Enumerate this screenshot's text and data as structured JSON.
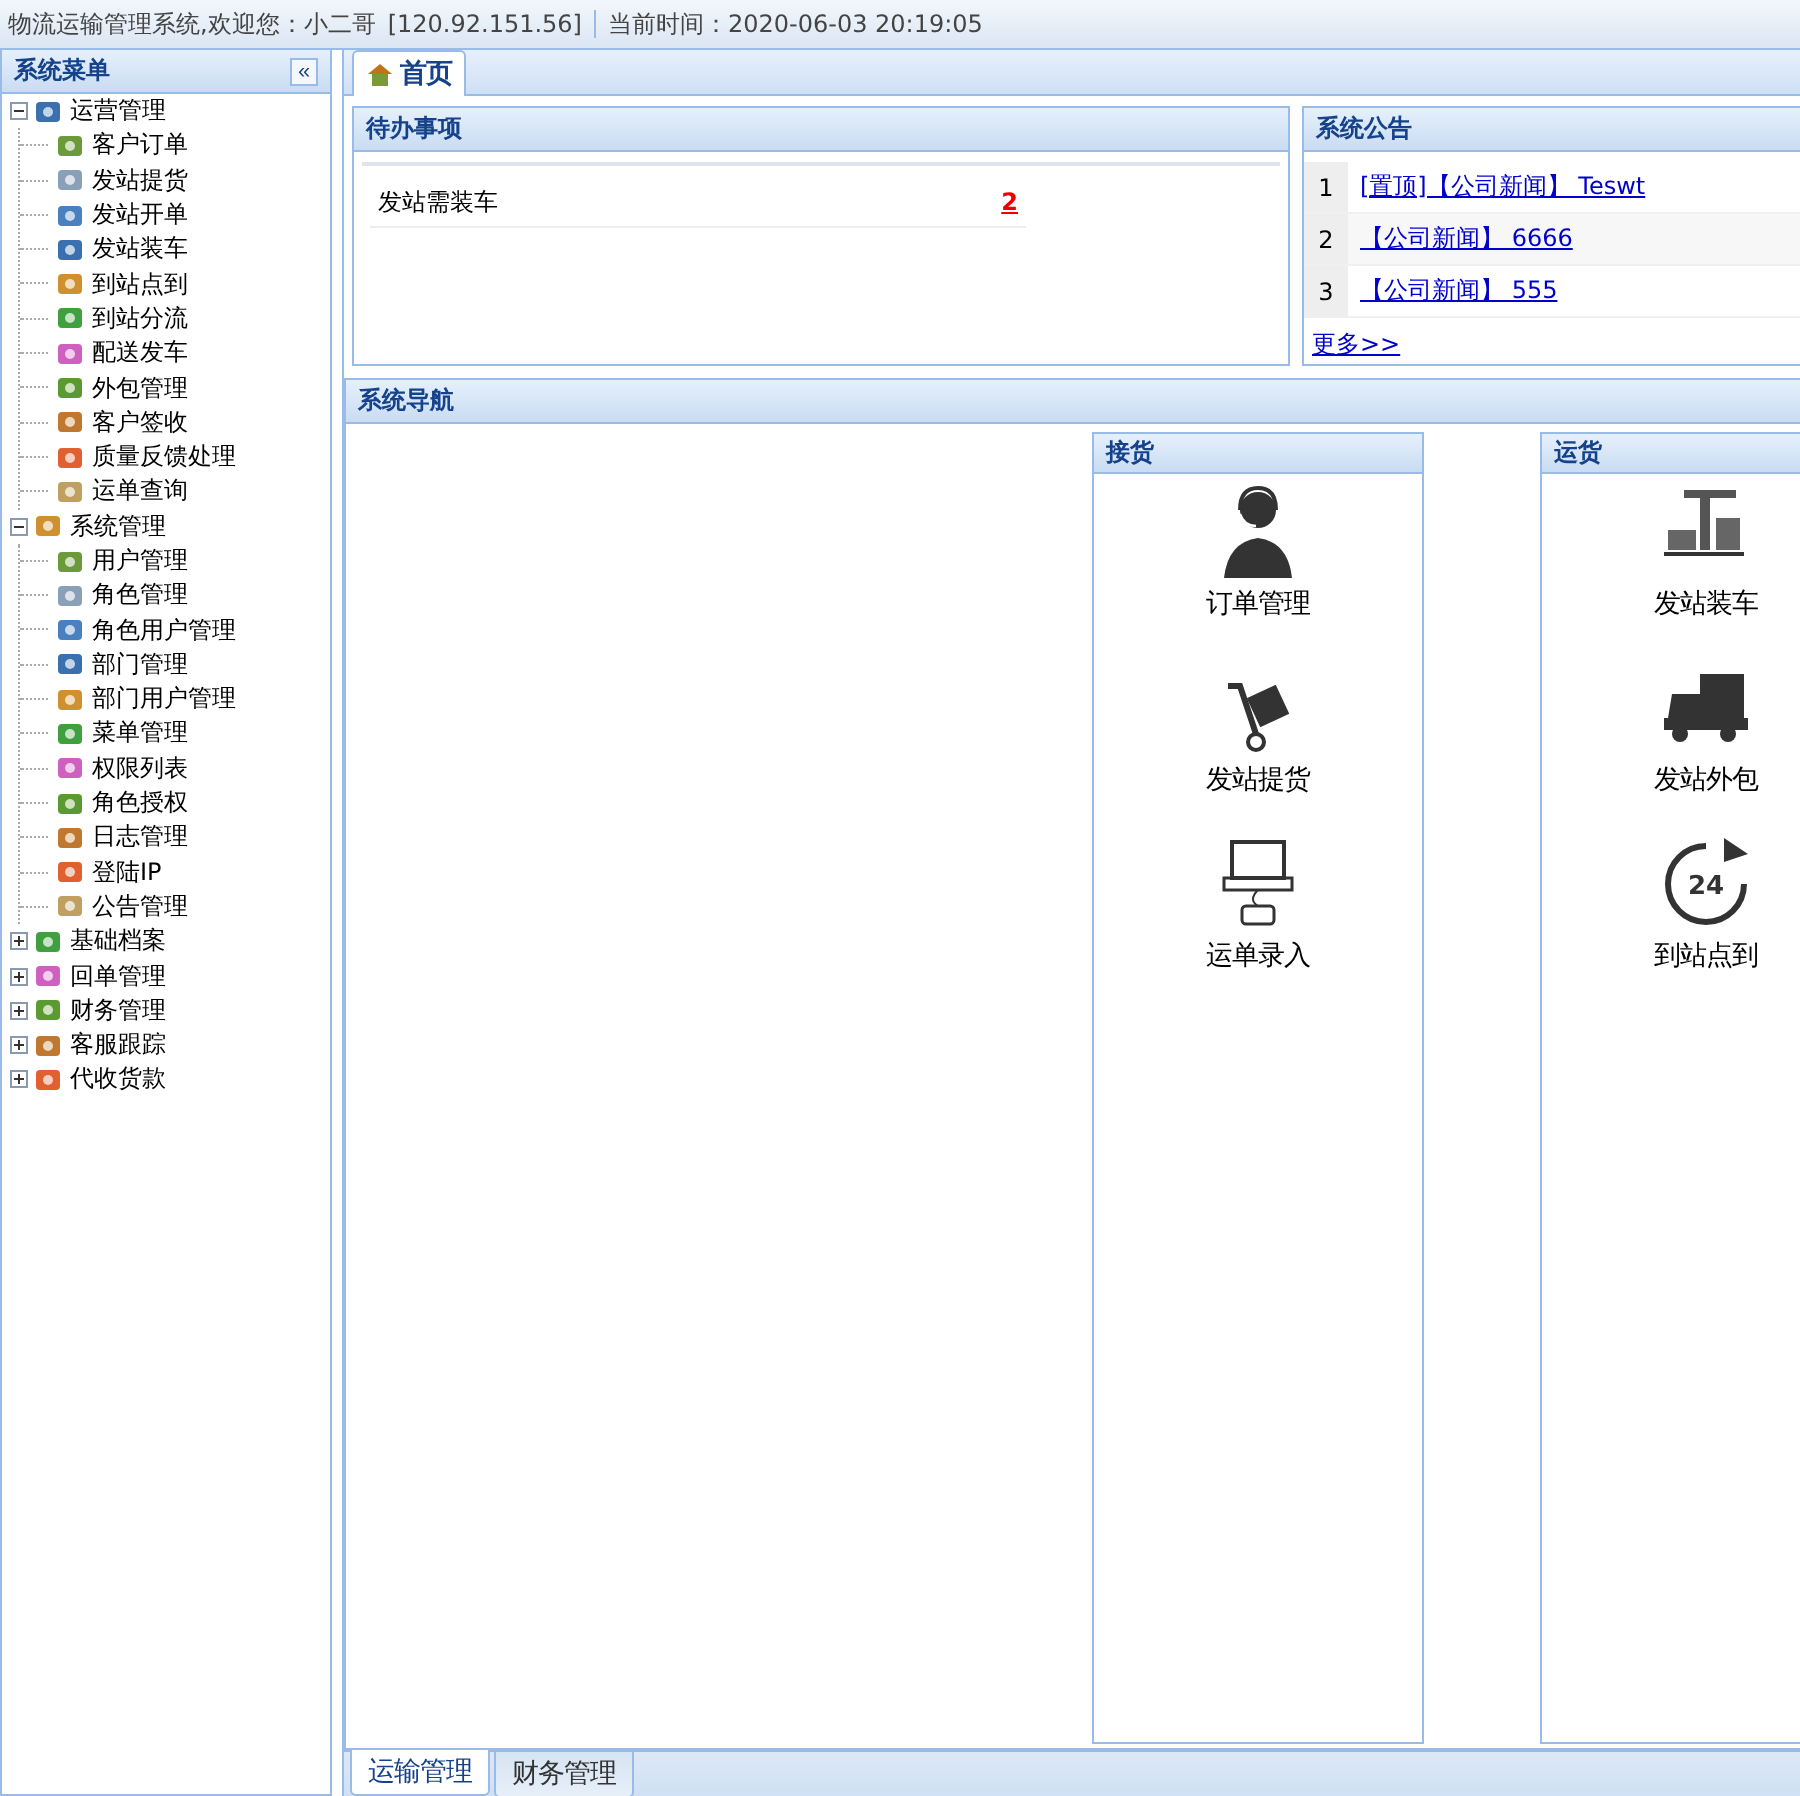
{
  "top_bar": {
    "welcome": "物流运输管理系统,欢迎您：小二哥",
    "ip": "[120.92.151.56]",
    "time": "当前时间：2020-06-03 20:19:05"
  },
  "sidebar": {
    "title": "系统菜单",
    "collapse": "«",
    "groups": [
      {
        "label": "运营管理",
        "expanded": true,
        "children": [
          {
            "label": "客户订单"
          },
          {
            "label": "发站提货"
          },
          {
            "label": "发站开单"
          },
          {
            "label": "发站装车"
          },
          {
            "label": "到站点到"
          },
          {
            "label": "到站分流"
          },
          {
            "label": "配送发车"
          },
          {
            "label": "外包管理"
          },
          {
            "label": "客户签收"
          },
          {
            "label": "质量反馈处理"
          },
          {
            "label": "运单查询"
          }
        ]
      },
      {
        "label": "系统管理",
        "expanded": true,
        "children": [
          {
            "label": "用户管理"
          },
          {
            "label": "角色管理"
          },
          {
            "label": "角色用户管理"
          },
          {
            "label": "部门管理"
          },
          {
            "label": "部门用户管理"
          },
          {
            "label": "菜单管理"
          },
          {
            "label": "权限列表"
          },
          {
            "label": "角色授权"
          },
          {
            "label": "日志管理"
          },
          {
            "label": "登陆IP"
          },
          {
            "label": "公告管理"
          }
        ]
      },
      {
        "label": "基础档案",
        "expanded": false
      },
      {
        "label": "回单管理",
        "expanded": false
      },
      {
        "label": "财务管理",
        "expanded": false
      },
      {
        "label": "客服跟踪",
        "expanded": false
      },
      {
        "label": "代收货款",
        "expanded": false
      }
    ]
  },
  "tabs": [
    {
      "label": "首页",
      "selected": true
    }
  ],
  "todo": {
    "title": "待办事项",
    "rows": [
      {
        "label": "发站需装车",
        "count": "2"
      }
    ]
  },
  "notices": {
    "title": "系统公告",
    "rows": [
      {
        "index": "1",
        "text": "[置顶]【公司新闻】 Teswt"
      },
      {
        "index": "2",
        "text": "【公司新闻】 6666"
      },
      {
        "index": "3",
        "text": "【公司新闻】 555"
      }
    ],
    "more": "更多>>"
  },
  "navigation": {
    "title": "系统导航",
    "columns": [
      {
        "title": "接货",
        "items": [
          {
            "label": "订单管理"
          },
          {
            "label": "发站提货"
          },
          {
            "label": "运单录入"
          }
        ]
      },
      {
        "title": "运货",
        "items": [
          {
            "label": "发站装车"
          },
          {
            "label": "发站外包"
          },
          {
            "label": "到站点到",
            "icon_text": "24"
          }
        ]
      }
    ]
  },
  "bottom_tabs": [
    {
      "label": "运输管理",
      "selected": true
    },
    {
      "label": "财务管理",
      "selected": false
    }
  ]
}
